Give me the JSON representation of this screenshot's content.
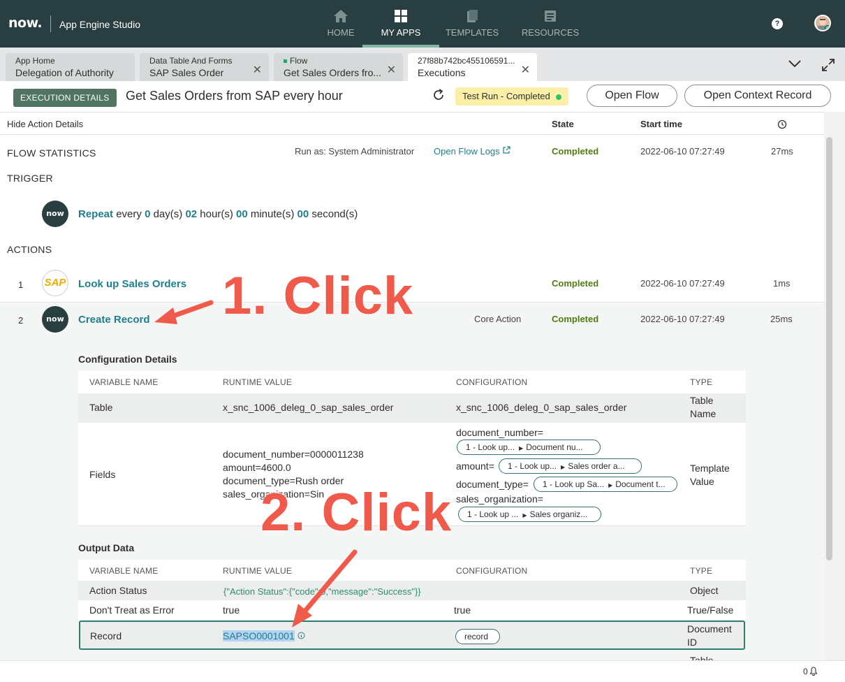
{
  "topbar": {
    "logo": "now.",
    "app_title": "App Engine Studio",
    "nav": [
      {
        "label": "HOME",
        "icon": "home-icon"
      },
      {
        "label": "MY APPS",
        "icon": "grid-icon"
      },
      {
        "label": "TEMPLATES",
        "icon": "templates-icon"
      },
      {
        "label": "RESOURCES",
        "icon": "resources-icon"
      }
    ],
    "help": "?"
  },
  "tabs": [
    {
      "line1": "App Home",
      "line2": "Delegation of Authority"
    },
    {
      "line1": "Data Table And Forms",
      "line2": "SAP Sales Order"
    },
    {
      "line1": "Flow",
      "line2": "Get Sales Orders fro..."
    },
    {
      "line1": "27f88b742bc455106591...",
      "line2": "Executions"
    }
  ],
  "header": {
    "badge": "EXECUTION DETAILS",
    "flow_title": "Get Sales Orders from SAP every hour",
    "status": "Test Run - Completed",
    "open_flow": "Open Flow",
    "open_context": "Open Context Record"
  },
  "columns": {
    "hide": "Hide Action Details",
    "state": "State",
    "start": "Start time"
  },
  "stats": {
    "title": "FLOW STATISTICS",
    "run_as": "Run as: System Administrator",
    "logs": "Open Flow Logs",
    "state": "Completed",
    "time": "2022-06-10 07:27:49",
    "dur": "27ms"
  },
  "trigger": {
    "title": "TRIGGER",
    "icon_label": "now",
    "name": "Repeat",
    "every": "every",
    "days": "0",
    "days_lbl": "day(s)",
    "hours": "02",
    "hours_lbl": "hour(s)",
    "minutes": "00",
    "minutes_lbl": "minute(s)",
    "seconds": "00",
    "seconds_lbl": "second(s)"
  },
  "actions": {
    "title": "ACTIONS",
    "items": [
      {
        "num": "1",
        "icon_label": "SAP",
        "name": "Look up Sales Orders",
        "type": "",
        "state": "Completed",
        "time": "2022-06-10 07:27:49",
        "dur": "1ms"
      },
      {
        "num": "2",
        "icon_label": "now",
        "name": "Create Record",
        "type": "Core Action",
        "state": "Completed",
        "time": "2022-06-10 07:27:49",
        "dur": "25ms"
      }
    ]
  },
  "config": {
    "title": "Configuration Details",
    "headers": [
      "VARIABLE NAME",
      "RUNTIME VALUE",
      "CONFIGURATION",
      "TYPE"
    ],
    "table_row": {
      "name": "Table",
      "runtime": "x_snc_1006_deleg_0_sap_sales_order",
      "config": "x_snc_1006_deleg_0_sap_sales_order",
      "type1": "Table",
      "type2": "Name"
    },
    "fields_row": {
      "name": "Fields",
      "runtime": [
        "document_number=0000011238",
        "amount=4600.0",
        "document_type=Rush order",
        "sales_organization=Sin"
      ],
      "c1": "document_number=",
      "p1a": "1 - Look up...",
      "p1b": "Document nu...",
      "c2": "amount=",
      "p2a": "1 - Look up...",
      "p2b": "Sales order a...",
      "c3": "document_type=",
      "p3a": "1 - Look up Sa...",
      "p3b": "Document t...",
      "c4": "sales_organization=",
      "p4a": "1 - Look up ...",
      "p4b": "Sales organiz...",
      "type1": "Template",
      "type2": "Value"
    }
  },
  "output": {
    "title": "Output Data",
    "headers": [
      "VARIABLE NAME",
      "RUNTIME VALUE",
      "CONFIGURATION",
      "TYPE"
    ],
    "rows": [
      {
        "name": "Action Status",
        "runtime": "{\"Action Status\":{\"code\":0,\"message\":\"Success\"}}",
        "config": "",
        "type1": "Object",
        "type2": ""
      },
      {
        "name": "Don't Treat as Error",
        "runtime": "true",
        "config": "true",
        "type1": "True/False",
        "type2": ""
      },
      {
        "name": "Record",
        "runtime": "SAPSO0001001",
        "config": "record",
        "type1": "Document",
        "type2": "ID"
      }
    ],
    "cut_type": "Table"
  },
  "footer": {
    "count": "0"
  },
  "annotations": {
    "step1": "1. Click",
    "step2": "2. Click",
    "arrow_color": "#f05a4a"
  }
}
